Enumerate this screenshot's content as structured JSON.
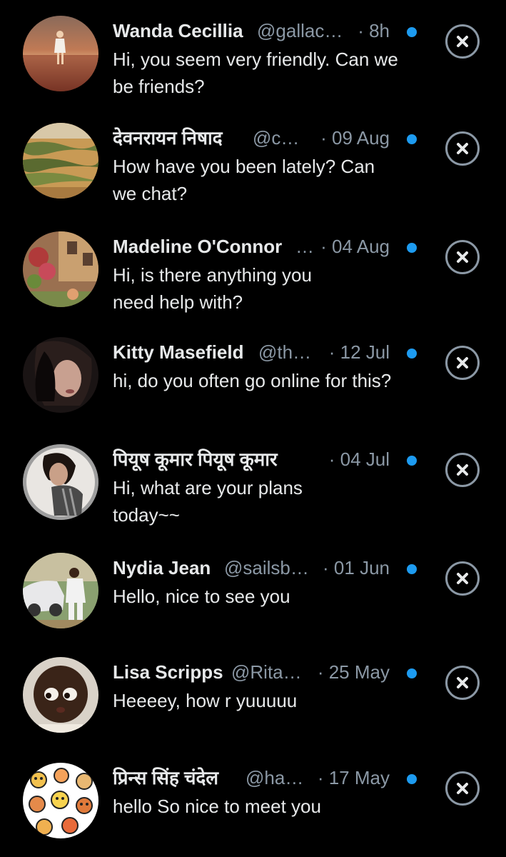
{
  "messages": [
    {
      "name": "Wanda Cecillia",
      "handle": "@gallac…",
      "time": "· 8h",
      "text": "Hi, you seem very friendly. Can we be friends?",
      "avatar": "woman-on-water-avatar"
    },
    {
      "name": "देवनरायन निषाद",
      "handle": "@ch…",
      "time": "· 09 Aug",
      "text": "How have you been lately? Can we chat?",
      "avatar": "landscape-avatar"
    },
    {
      "name": "Madeline O'Connor",
      "handle": "…",
      "time": "· 04 Aug",
      "text": "Hi, is there anything you need help with?",
      "avatar": "flowers-house-avatar"
    },
    {
      "name": "Kitty Masefield",
      "handle": "@th…",
      "time": "· 12 Jul",
      "text": "hi, do you often go online for this?",
      "avatar": "dark-hair-woman-avatar"
    },
    {
      "name": "पियूष कूमार पियूष कूमार",
      "handle": "",
      "time": "· 04 Jul",
      "text": "Hi, what are your plans today~~",
      "avatar": "woman-portrait-avatar"
    },
    {
      "name": "Nydia Jean",
      "handle": "@sailsb…",
      "time": "· 01 Jun",
      "text": "Hello, nice to see you",
      "avatar": "man-with-car-avatar"
    },
    {
      "name": "Lisa Scripps",
      "handle": "@Rita…",
      "time": "· 25 May",
      "text": "Heeeey, how r yuuuuu",
      "avatar": "baby-face-avatar"
    },
    {
      "name": "प्रिन्स सिंह चंदेल",
      "handle": "@ha…",
      "time": "· 17 May",
      "text": "hello  So nice to meet you",
      "avatar": "cartoon-faces-avatar"
    }
  ],
  "colors": {
    "background": "#000000",
    "text": "#e7e9ea",
    "secondary": "#8b98a5",
    "unread_dot": "#1d9bf0"
  },
  "icons": {
    "dismiss": "close-circle-icon",
    "unread": "unread-dot-icon"
  }
}
